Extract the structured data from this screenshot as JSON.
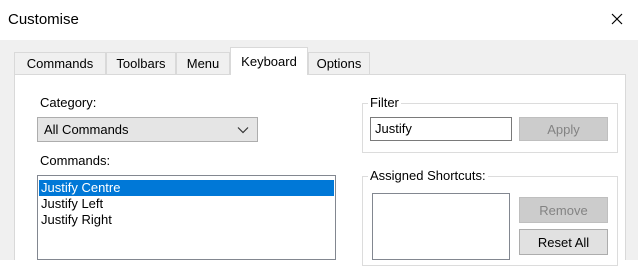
{
  "window": {
    "title": "Customise"
  },
  "tabs": [
    {
      "label": "Commands",
      "active": false
    },
    {
      "label": "Toolbars",
      "active": false
    },
    {
      "label": "Menu",
      "active": false
    },
    {
      "label": "Keyboard",
      "active": true
    },
    {
      "label": "Options",
      "active": false
    }
  ],
  "category": {
    "label": "Category:",
    "selected": "All Commands"
  },
  "commands": {
    "label": "Commands:",
    "items": [
      {
        "text": "Justify Centre",
        "selected": true
      },
      {
        "text": "Justify Left",
        "selected": false
      },
      {
        "text": "Justify Right",
        "selected": false
      }
    ]
  },
  "filter": {
    "title": "Filter",
    "value": "Justify",
    "apply_label": "Apply"
  },
  "shortcuts": {
    "title": "Assigned Shortcuts:",
    "remove_label": "Remove",
    "reset_label": "Reset All"
  },
  "colors": {
    "selection": "#0078d7",
    "dialog_bg": "#f0f0f0",
    "panel_bg": "#ffffff"
  },
  "icons": {
    "close": "close-icon",
    "dropdown": "chevron-down-icon"
  }
}
